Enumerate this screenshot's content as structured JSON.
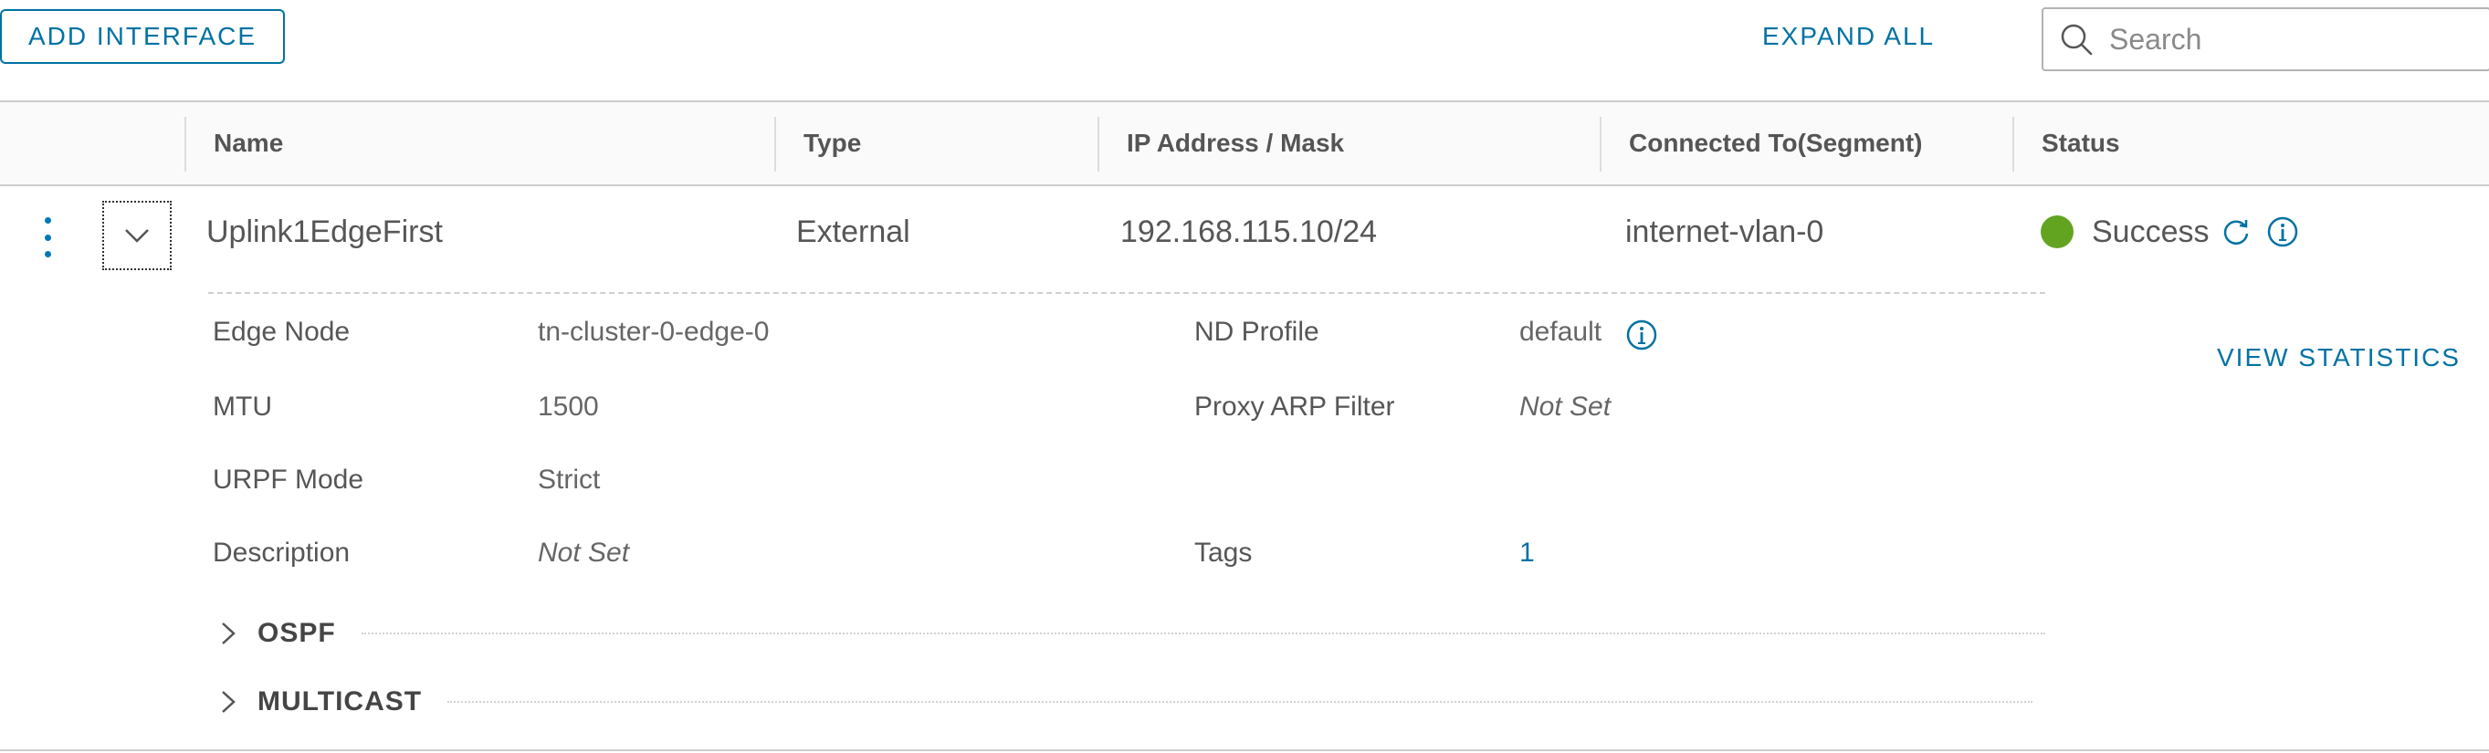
{
  "toolbar": {
    "add_interface_label": "ADD INTERFACE",
    "expand_all_label": "EXPAND ALL",
    "search_placeholder": "Search"
  },
  "grid": {
    "columns": [
      "Name",
      "Type",
      "IP Address / Mask",
      "Connected To(Segment)",
      "Status"
    ],
    "rows": [
      {
        "name": "Uplink1EdgeFirst",
        "type": "External",
        "ip": "192.168.115.10/24",
        "segment": "internet-vlan-0",
        "status": "Success",
        "status_color": "#62a420",
        "expanded": true,
        "details": {
          "edge_node_label": "Edge Node",
          "edge_node_value": "tn-cluster-0-edge-0",
          "mtu_label": "MTU",
          "mtu_value": "1500",
          "urpf_label": "URPF Mode",
          "urpf_value": "Strict",
          "description_label": "Description",
          "description_value": "Not Set",
          "nd_profile_label": "ND Profile",
          "nd_profile_value": "default",
          "proxy_arp_label": "Proxy ARP Filter",
          "proxy_arp_value": "Not Set",
          "tags_label": "Tags",
          "tags_value": "1",
          "view_statistics_label": "VIEW STATISTICS",
          "sections": [
            "OSPF",
            "MULTICAST"
          ]
        }
      }
    ]
  },
  "colors": {
    "accent": "#0072a3",
    "success": "#62a420"
  },
  "icons": {
    "search": "search-icon",
    "row_actions": "kebab-menu-icon",
    "expander": "chevron-down-icon",
    "refresh": "refresh-icon",
    "info": "info-icon",
    "section_expander": "chevron-right-icon"
  }
}
